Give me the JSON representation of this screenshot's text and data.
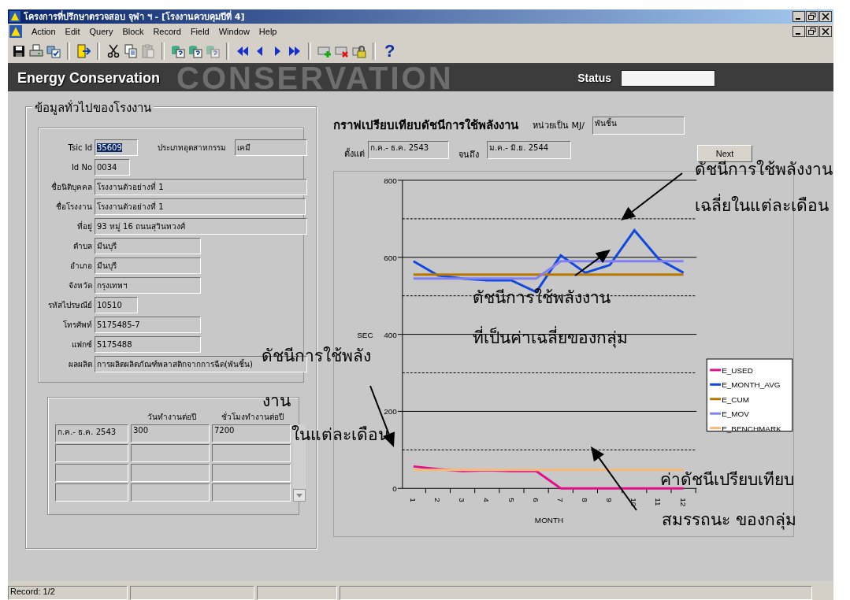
{
  "window": {
    "title": "โครงการที่ปรึกษาตรวจสอบ จุฬา ฯ - [โรงงานควบคุมปีที่ 4]"
  },
  "menu": [
    "Action",
    "Edit",
    "Query",
    "Block",
    "Record",
    "Field",
    "Window",
    "Help"
  ],
  "toolbar": {
    "help_glyph": "?"
  },
  "banner": {
    "art_text": "CONSERVATION",
    "title": "Energy Conservation",
    "status_label": "Status"
  },
  "general_info": {
    "heading": "ข้อมูลทั่วไปของโรงงาน",
    "fields": [
      {
        "label": "Tsic Id",
        "value": "35609",
        "selected": true
      },
      {
        "label": "Id No",
        "value": "0034",
        "selected": false
      },
      {
        "label": "ชื่อนิติบุคคล",
        "value": "โรงงานตัวอย่างที่ 1",
        "selected": false
      },
      {
        "label": "ชื่อโรงงาน",
        "value": "โรงงานตัวอย่างที่ 1",
        "selected": false
      },
      {
        "label": "ที่อยู่",
        "value": "93 หมู่ 16 ถนนสุวินทวงศ์",
        "selected": false
      },
      {
        "label": "ตำบล",
        "value": "มีนบุรี",
        "selected": false
      },
      {
        "label": "อำเภอ",
        "value": "มีนบุรี",
        "selected": false
      },
      {
        "label": "จังหวัด",
        "value": "กรุงเทพฯ",
        "selected": false
      },
      {
        "label": "รหัสไปรษณีย์",
        "value": "10510",
        "selected": false
      },
      {
        "label": "โทรศัพท์",
        "value": "5175485-7",
        "selected": false
      },
      {
        "label": "แฟกซ์",
        "value": "5175488",
        "selected": false
      },
      {
        "label": "ผลผลิต",
        "value": "การผลิตผลิตภัณฑ์พลาสติกจากการฉีด(พันชิ้น)",
        "selected": false
      }
    ],
    "industry_type": {
      "label": "ประเภทอุตสาหกรรม",
      "value": "เคมี"
    }
  },
  "work_table": {
    "columns": [
      "",
      "วันทำงานต่อปี",
      "ชั่วโมงทำงานต่อปี"
    ],
    "rows": [
      [
        "ก.ค.- ธ.ค. 2543",
        "300",
        "7200"
      ]
    ]
  },
  "comparison": {
    "title": "กราฟเปรียบเทียบดัชนีการใช้พลังงาน",
    "unit_label": "หน่วยเป็น MJ/",
    "unit_value": "พันชิ้น",
    "from_label": "ตั้งแต่",
    "from_value": "ก.ค.- ธ.ค. 2543",
    "to_label": "จนถึง",
    "to_value": "ม.ค.- มิ.ย. 2544",
    "next_button": "Next",
    "chart_data": {
      "type": "line",
      "grid": true,
      "legend": true,
      "xlabel": "MONTH",
      "ylabel": "SEC",
      "categories": [
        "1",
        "2",
        "3",
        "4",
        "5",
        "6",
        "7",
        "8",
        "9",
        "10",
        "11",
        "12"
      ],
      "ylim": [
        0,
        800
      ],
      "yticks": [
        0,
        200,
        400,
        600,
        800
      ],
      "series": [
        {
          "name": "E_USED",
          "color": "#e0108a",
          "values": [
            57,
            50,
            45,
            47,
            45,
            45,
            0,
            0,
            0,
            0,
            0,
            0
          ]
        },
        {
          "name": "E_MONTH_AVG",
          "color": "#1048e0",
          "values": [
            590,
            553,
            545,
            540,
            540,
            510,
            605,
            560,
            580,
            670,
            595,
            560
          ]
        },
        {
          "name": "E_CUM",
          "color": "#b87800",
          "values": [
            555,
            555,
            555,
            555,
            555,
            555,
            555,
            555,
            555,
            555,
            555,
            555
          ]
        },
        {
          "name": "E_MOV",
          "color": "#8080f0",
          "values": [
            545,
            545,
            545,
            545,
            545,
            545,
            590,
            590,
            590,
            590,
            590,
            590
          ]
        },
        {
          "name": "E_BENCHMARK",
          "color": "#f8b878",
          "values": [
            48,
            48,
            48,
            48,
            48,
            48,
            48,
            48,
            48,
            48,
            48,
            48
          ]
        }
      ]
    }
  },
  "annotations": [
    {
      "lines": [
        "ดัชนีการใช้พลังงาน",
        "เฉลี่ยในแต่ละเดือน"
      ]
    },
    {
      "lines": [
        "ดัชนีการใช้พลังงาน",
        "ที่เป็นค่าเฉลี่ยของกลุ่ม"
      ]
    },
    {
      "lines": [
        "ดัชนีการใช้พลัง",
        "งาน",
        "ในแต่ละเดือน"
      ]
    },
    {
      "lines": [
        "ค่าดัชนีเปรียบเทียบ",
        "สมรรถนะ ของกลุ่ม"
      ]
    }
  ],
  "status_bar": {
    "record": "Record: 1/2"
  }
}
